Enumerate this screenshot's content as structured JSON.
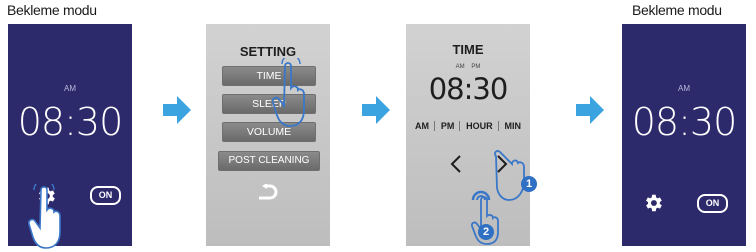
{
  "captions": {
    "left": "Bekleme modu",
    "right": "Bekleme modu"
  },
  "standby": {
    "ampm": "AM",
    "time": "08:30",
    "on_label": "ON"
  },
  "setting": {
    "title": "SETTING",
    "items": [
      "TIME",
      "SLEEP",
      "VOLUME",
      "POST CLEANING"
    ]
  },
  "time_screen": {
    "title": "TIME",
    "ampm_indicator": "AM   PM",
    "time": "08:30",
    "tabs": [
      "AM",
      "PM",
      "HOUR",
      "MIN"
    ]
  },
  "steps": [
    "1",
    "2"
  ],
  "colors": {
    "standby_bg": "#2d2a6c",
    "arrow": "#3aa3e0",
    "hand_stroke": "#3a77c8",
    "step_badge": "#2f6fc4"
  },
  "icons": [
    "settings-gear-icon",
    "back-return-icon",
    "chevron-left-icon",
    "chevron-right-icon",
    "hand-pointer-icon",
    "confirm-icon"
  ]
}
